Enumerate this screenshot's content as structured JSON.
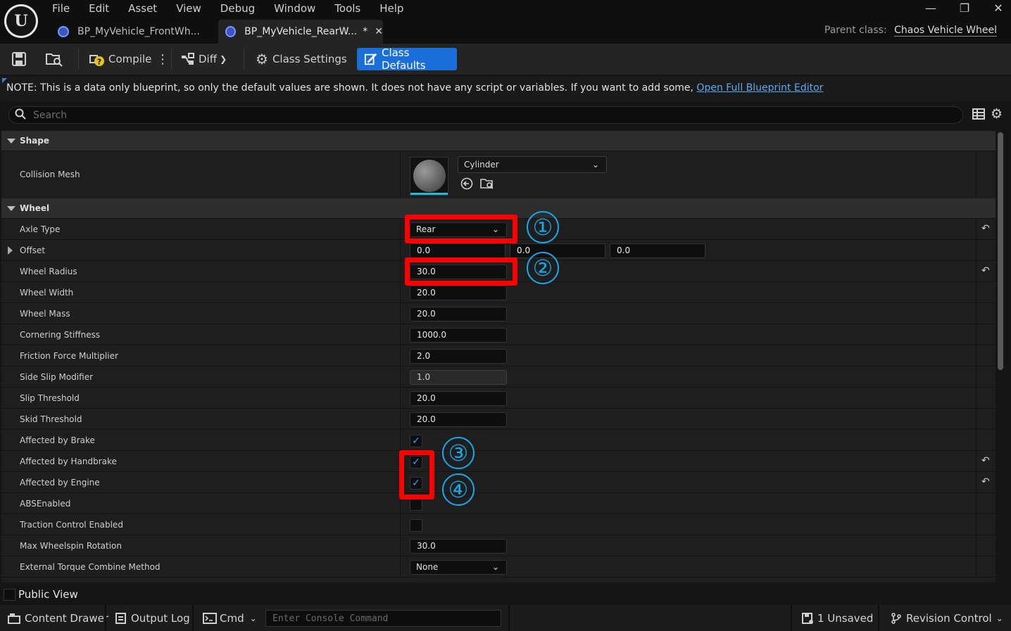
{
  "menu": [
    "File",
    "Edit",
    "Asset",
    "View",
    "Debug",
    "Window",
    "Tools",
    "Help"
  ],
  "window_controls": [
    "—",
    "❐",
    "✕"
  ],
  "tabs": [
    {
      "label": "BP_MyVehicle_FrontWh..."
    },
    {
      "label": "BP_MyVehicle_RearW...",
      "modified": "*",
      "close": "✕"
    }
  ],
  "parent_class": {
    "label": "Parent class:",
    "value": "Chaos Vehicle Wheel"
  },
  "toolbar": {
    "compile": "Compile",
    "diff": "Diff",
    "class_settings": "Class Settings",
    "class_defaults": "Class Defaults"
  },
  "notice": {
    "text": "NOTE: This is a data only blueprint, so only the default values are shown.  It does not have any script or variables.  If you want to add some, ",
    "link": "Open Full Blueprint Editor"
  },
  "search": {
    "placeholder": "Search"
  },
  "categories": {
    "shape": "Shape",
    "wheel": "Wheel"
  },
  "collision_mesh": {
    "label": "Collision Mesh",
    "value": "Cylinder"
  },
  "props": {
    "axle_type": {
      "label": "Axle Type",
      "value": "Rear"
    },
    "offset": {
      "label": "Offset",
      "x": "0.0",
      "y": "0.0",
      "z": "0.0"
    },
    "wheel_radius": {
      "label": "Wheel Radius",
      "value": "30.0"
    },
    "wheel_width": {
      "label": "Wheel Width",
      "value": "20.0"
    },
    "wheel_mass": {
      "label": "Wheel Mass",
      "value": "20.0"
    },
    "cornering_stiffness": {
      "label": "Cornering Stiffness",
      "value": "1000.0"
    },
    "friction_force_multiplier": {
      "label": "Friction Force Multiplier",
      "value": "2.0"
    },
    "side_slip_modifier": {
      "label": "Side Slip Modifier",
      "value": "1.0"
    },
    "slip_threshold": {
      "label": "Slip Threshold",
      "value": "20.0"
    },
    "skid_threshold": {
      "label": "Skid Threshold",
      "value": "20.0"
    },
    "affected_by_brake": {
      "label": "Affected by Brake",
      "checked": true
    },
    "affected_by_handbrake": {
      "label": "Affected by Handbrake",
      "checked": true
    },
    "affected_by_engine": {
      "label": "Affected by Engine",
      "checked": true
    },
    "abs_enabled": {
      "label": "ABSEnabled",
      "checked": false
    },
    "traction_control_enabled": {
      "label": "Traction Control Enabled",
      "checked": false
    },
    "max_wheelspin_rotation": {
      "label": "Max Wheelspin Rotation",
      "value": "30.0"
    },
    "external_torque_combine_method": {
      "label": "External Torque Combine Method",
      "value": "None"
    }
  },
  "annotations": [
    "①",
    "②",
    "③",
    "④"
  ],
  "public_view": "Public View",
  "statusbar": {
    "content_drawer": "Content Drawer",
    "output_log": "Output Log",
    "cmd": "Cmd",
    "console_placeholder": "Enter Console Command",
    "unsaved": "1 Unsaved",
    "revision_control": "Revision Control"
  },
  "colors": {
    "accent": "#1a6ed8",
    "highlight": "#ff0000",
    "annotation": "#1aa6e8",
    "link": "#5aaaf0"
  }
}
